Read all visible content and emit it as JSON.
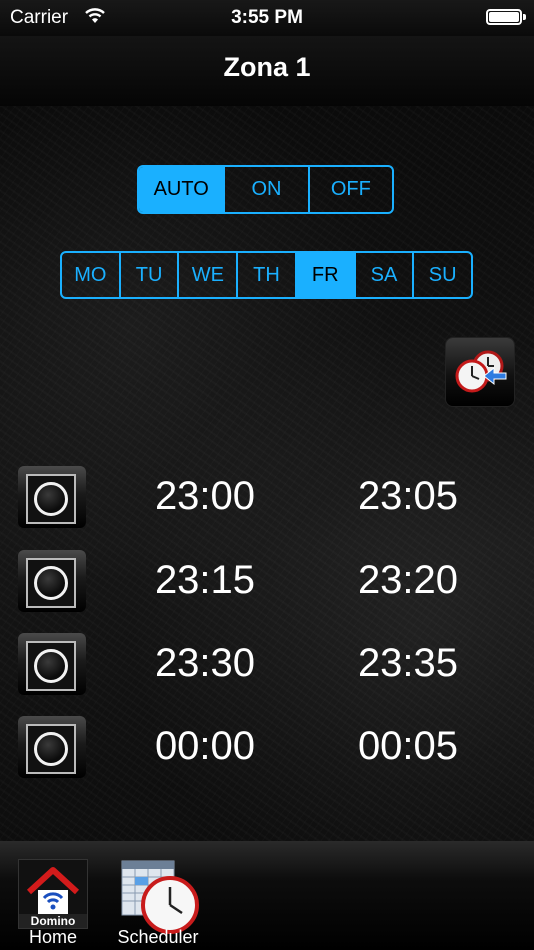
{
  "status_bar": {
    "carrier": "Carrier",
    "time": "3:55 PM",
    "battery_level": 1.0
  },
  "nav": {
    "title": "Zona 1"
  },
  "mode_control": {
    "options": [
      "AUTO",
      "ON",
      "OFF"
    ],
    "selected": "AUTO"
  },
  "day_control": {
    "options": [
      "MO",
      "TU",
      "WE",
      "TH",
      "FR",
      "SA",
      "SU"
    ],
    "selected": "FR"
  },
  "copy_schedule_icon": "clock-copy-icon",
  "schedule": [
    {
      "start": "23:00",
      "end": "23:05",
      "enabled": false
    },
    {
      "start": "23:15",
      "end": "23:20",
      "enabled": false
    },
    {
      "start": "23:30",
      "end": "23:35",
      "enabled": false
    },
    {
      "start": "00:00",
      "end": "00:05",
      "enabled": false
    }
  ],
  "tab_bar": {
    "home": {
      "label": "Home",
      "logo_text": "Domino",
      "icon": "house-wifi-icon"
    },
    "scheduler": {
      "label": "Scheduler",
      "icon": "calendar-clock-icon"
    }
  },
  "colors": {
    "accent": "#1ab0ff",
    "background": "#000000"
  }
}
